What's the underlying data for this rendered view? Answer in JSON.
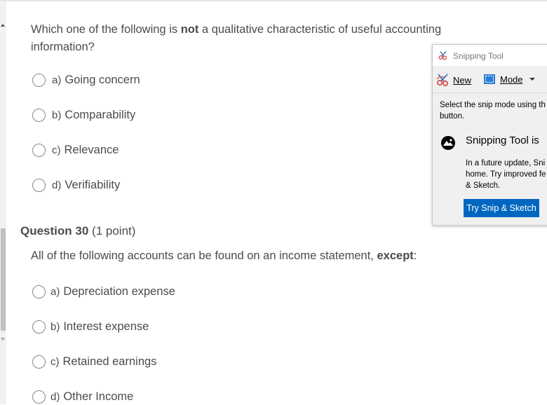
{
  "question_29": {
    "text_before": "Which one of the following is ",
    "text_bold": "not",
    "text_after": " a qualitative characteristic of useful accounting information?",
    "options": [
      {
        "letter": "a)",
        "label": "Going concern"
      },
      {
        "letter": "b)",
        "label": "Comparability"
      },
      {
        "letter": "c)",
        "label": "Relevance"
      },
      {
        "letter": "d)",
        "label": "Verifiability"
      }
    ]
  },
  "question_30": {
    "title": "Question 30",
    "points": "(1 point)",
    "text_before": "All of the following accounts can be found on an income statement, ",
    "text_bold": "except",
    "text_after": ":",
    "options": [
      {
        "letter": "a)",
        "label": "Depreciation expense"
      },
      {
        "letter": "b)",
        "label": "Interest expense"
      },
      {
        "letter": "c)",
        "label": "Retained earnings"
      },
      {
        "letter": "d)",
        "label": "Other Income"
      }
    ]
  },
  "snipping_tool": {
    "title": "Snipping Tool",
    "new_label": "New",
    "mode_label": "Mode",
    "hint_line1": "Select the snip mode using th",
    "hint_line2": "button.",
    "notice_title": "Snipping Tool is",
    "notice_line1": "In a future update, Sni",
    "notice_line2": "home. Try improved fe",
    "notice_line3": "& Sketch.",
    "button_label": "Try Snip & Sketch",
    "accent_color": "#0067c0"
  }
}
